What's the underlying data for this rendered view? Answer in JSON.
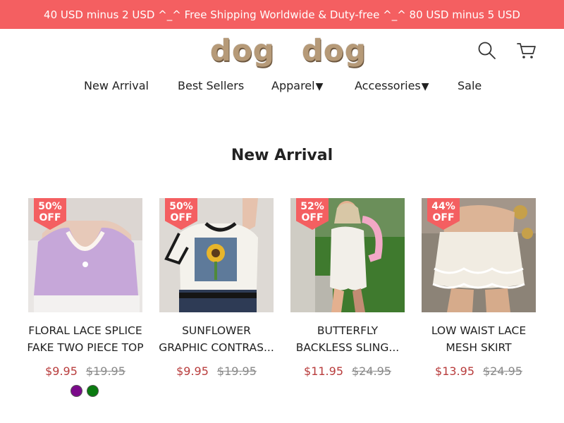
{
  "announcement": "40 USD minus 2 USD ^_^ Free Shipping Worldwide & Duty-free ^_^ 80 USD minus 5 USD",
  "logo": {
    "word_left": "dog",
    "word_right": "dog"
  },
  "header": {
    "search_icon": "search-icon",
    "cart_icon": "cart-icon"
  },
  "nav": [
    {
      "label": "New Arrival",
      "has_dropdown": false
    },
    {
      "label": "Best Sellers",
      "has_dropdown": false
    },
    {
      "label": "Apparel",
      "has_dropdown": true
    },
    {
      "label": "Accessories",
      "has_dropdown": true
    },
    {
      "label": "Sale",
      "has_dropdown": false
    }
  ],
  "nav_caret": "▼",
  "section_title": "New Arrival",
  "colors": {
    "accent": "#f45f61",
    "sale_price": "#b83c3c",
    "logo": "#b69a78"
  },
  "products": [
    {
      "badge_pct": "50%",
      "badge_off": "OFF",
      "title_line1": "FLORAL LACE SPLICE",
      "title_line2": "FAKE TWO PIECE TOP",
      "price": "$9.95",
      "original_price": "$19.95",
      "swatches": [
        "#7b0a8a",
        "#0a7a10"
      ]
    },
    {
      "badge_pct": "50%",
      "badge_off": "OFF",
      "title_line1": "SUNFLOWER",
      "title_line2": "GRAPHIC CONTRAS...",
      "price": "$9.95",
      "original_price": "$19.95",
      "swatches": []
    },
    {
      "badge_pct": "52%",
      "badge_off": "OFF",
      "title_line1": "BUTTERFLY",
      "title_line2": "BACKLESS SLING...",
      "price": "$11.95",
      "original_price": "$24.95",
      "swatches": []
    },
    {
      "badge_pct": "44%",
      "badge_off": "OFF",
      "title_line1": "LOW WAIST LACE",
      "title_line2": "MESH SKIRT",
      "price": "$13.95",
      "original_price": "$24.95",
      "swatches": []
    }
  ]
}
